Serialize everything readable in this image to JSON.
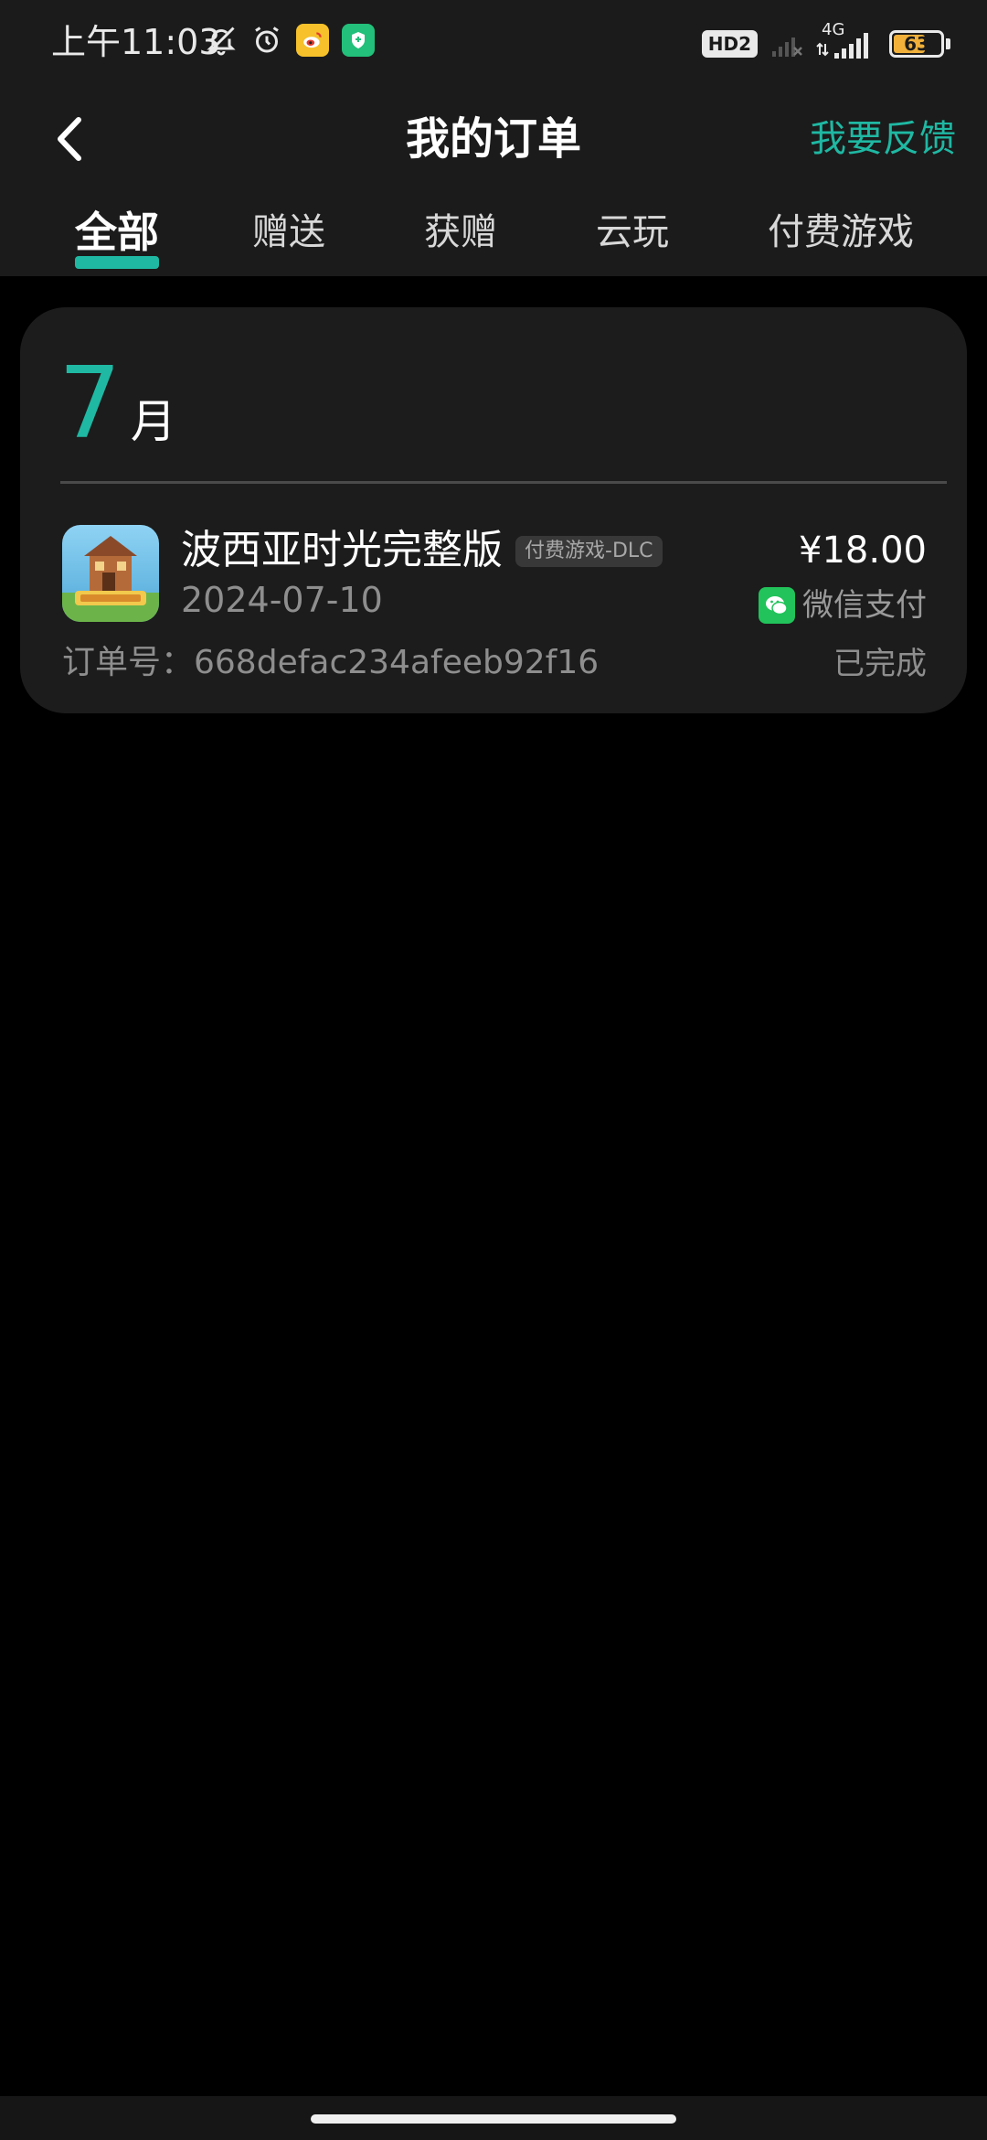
{
  "status_bar": {
    "time": "上午11:03",
    "left_icons": [
      "bell-off-icon",
      "alarm-icon",
      "weibo-app-icon",
      "shield-app-icon"
    ],
    "hd_label": "HD2",
    "network_label": "4G",
    "battery_level": "63"
  },
  "header": {
    "title": "我的订单",
    "feedback_label": "我要反馈"
  },
  "tabs": [
    {
      "label": "全部",
      "active": true
    },
    {
      "label": "赠送",
      "active": false
    },
    {
      "label": "获赠",
      "active": false
    },
    {
      "label": "云玩",
      "active": false
    },
    {
      "label": "付费游戏",
      "active": false
    }
  ],
  "order_group": {
    "month_number": "7",
    "month_suffix": "月",
    "order": {
      "title": "波西亚时光完整版",
      "tag": "付费游戏-DLC",
      "date": "2024-07-10",
      "price": "¥18.00",
      "payment_method": "微信支付",
      "order_number": "订单号：668defac234afeeb92f16",
      "status": "已完成"
    }
  },
  "colors": {
    "accent": "#1fb8a3",
    "background": "#000000",
    "surface": "#1c1c1c",
    "wechat": "#21c35a"
  }
}
